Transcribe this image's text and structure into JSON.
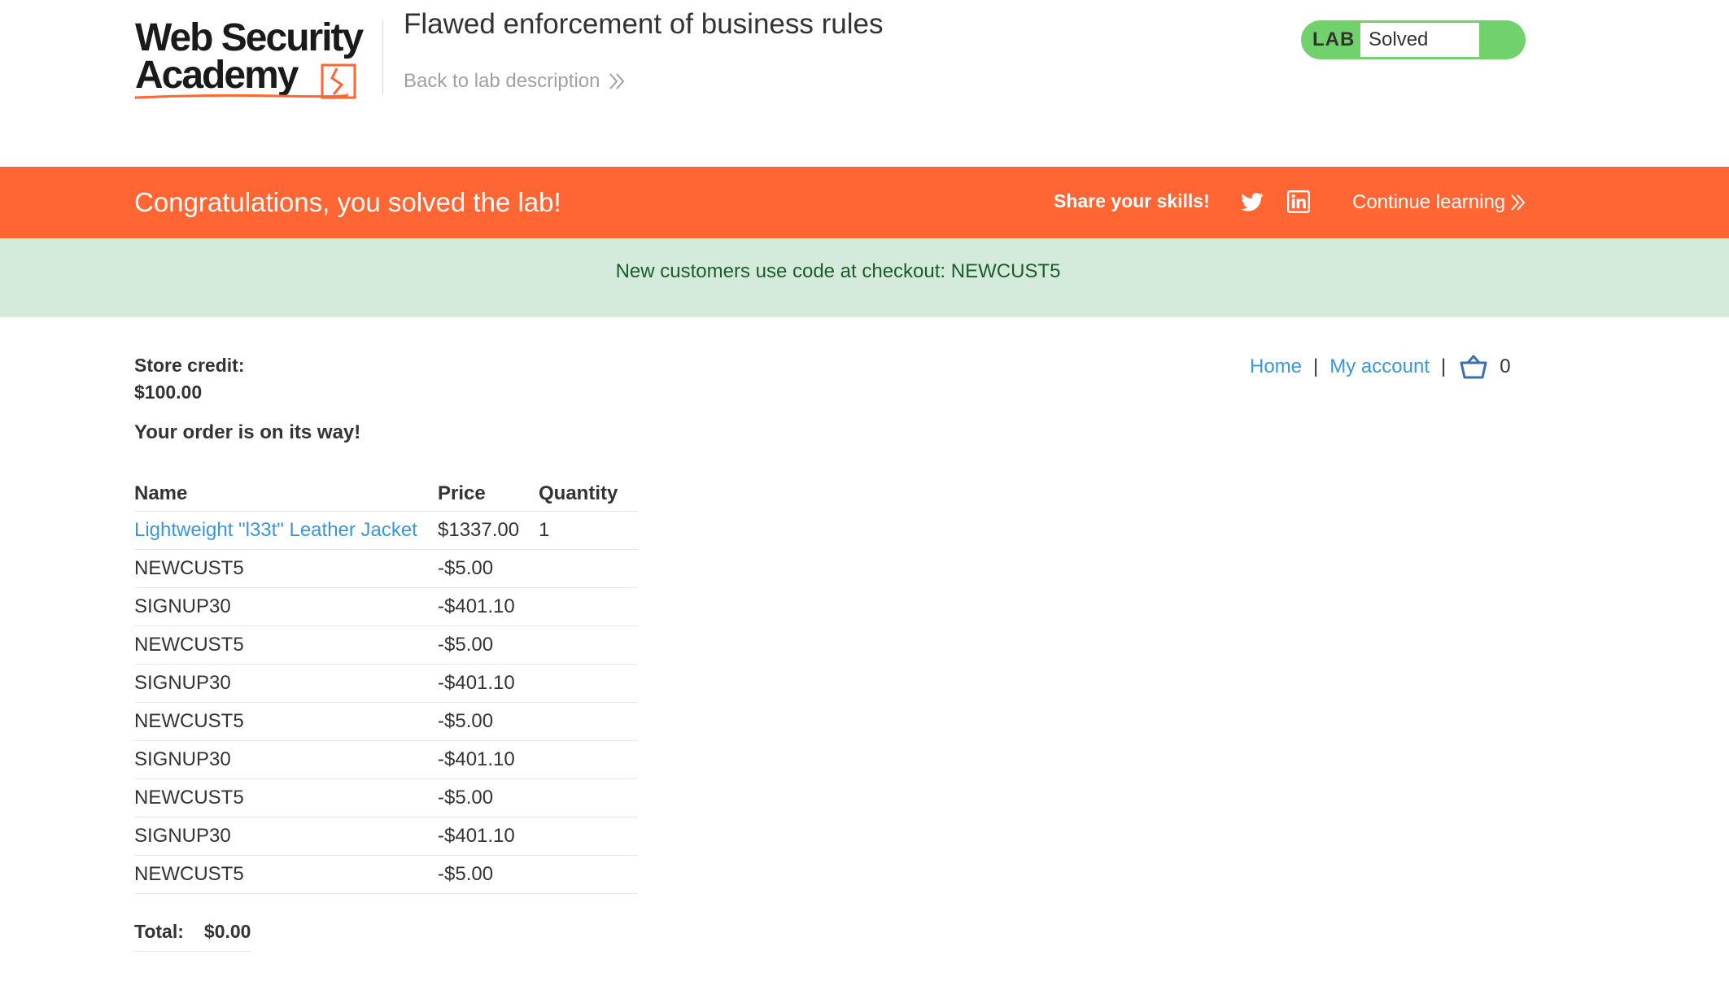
{
  "header": {
    "logo_line1": "Web Security",
    "logo_line2": "Academy",
    "lab_title": "Flawed enforcement of business rules",
    "back_link": "Back to lab description",
    "status_prefix": "LAB",
    "status_value": "Solved"
  },
  "banner": {
    "message": "Congratulations, you solved the lab!",
    "share_label": "Share your skills!",
    "continue_label": "Continue learning"
  },
  "notice": {
    "text": "New customers use code at checkout: NEWCUST5"
  },
  "nav": {
    "home": "Home",
    "separator": "|",
    "my_account": "My account",
    "cart_count": "0"
  },
  "main": {
    "credit_label": "Store credit:",
    "credit_value": "$100.00",
    "order_message": "Your order is on its way!",
    "table": {
      "headers": [
        "Name",
        "Price",
        "Quantity"
      ],
      "rows": [
        {
          "name": "Lightweight \"l33t\" Leather Jacket",
          "price": "$1337.00",
          "quantity": "1",
          "link": true
        },
        {
          "name": "NEWCUST5",
          "price": "-$5.00",
          "quantity": ""
        },
        {
          "name": "SIGNUP30",
          "price": "-$401.10",
          "quantity": ""
        },
        {
          "name": "NEWCUST5",
          "price": "-$5.00",
          "quantity": ""
        },
        {
          "name": "SIGNUP30",
          "price": "-$401.10",
          "quantity": ""
        },
        {
          "name": "NEWCUST5",
          "price": "-$5.00",
          "quantity": ""
        },
        {
          "name": "SIGNUP30",
          "price": "-$401.10",
          "quantity": ""
        },
        {
          "name": "NEWCUST5",
          "price": "-$5.00",
          "quantity": ""
        },
        {
          "name": "SIGNUP30",
          "price": "-$401.10",
          "quantity": ""
        },
        {
          "name": "NEWCUST5",
          "price": "-$5.00",
          "quantity": ""
        }
      ]
    },
    "total_label": "Total:",
    "total_value": "$0.00"
  },
  "colors": {
    "brand_orange": "#ff6633",
    "solved_green": "#70d16d",
    "link_blue": "#3a97d4",
    "notice_bg": "#d4ebdc",
    "notice_text": "#1c5c2a"
  },
  "icons": [
    "logo-icon",
    "chevron-double-right-icon",
    "twitter-icon",
    "linkedin-icon",
    "cart-icon"
  ]
}
